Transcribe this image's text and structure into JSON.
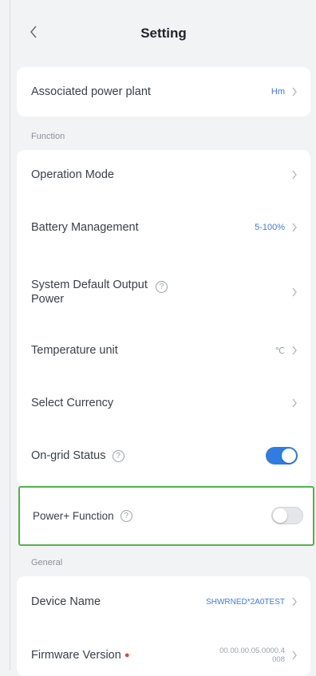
{
  "header": {
    "title": "Setting"
  },
  "plant": {
    "label": "Associated power plant",
    "value": "Hm"
  },
  "function": {
    "section_label": "Function",
    "operation_mode": {
      "label": "Operation Mode"
    },
    "battery_management": {
      "label": "Battery Management",
      "value": "5-100%"
    },
    "system_output": {
      "label": "System Default Output Power"
    },
    "temperature_unit": {
      "label": "Temperature unit",
      "value": "℃"
    },
    "currency": {
      "label": "Select Currency"
    },
    "on_grid": {
      "label": "On-grid Status",
      "enabled": true
    },
    "power_plus": {
      "label": "Power+ Function",
      "enabled": false
    }
  },
  "general": {
    "section_label": "General",
    "device_name": {
      "label": "Device Name",
      "value": "SHWRNED*2A0TEST"
    },
    "firmware": {
      "label": "Firmware Version",
      "value": "00.00.00.05.0000.4",
      "value2": "008"
    }
  },
  "icons": {
    "help": "?",
    "back": "chevron-left",
    "chevron": "chevron-right"
  },
  "colors": {
    "accent": "#2f7de1",
    "highlight_border": "#53b24a"
  }
}
